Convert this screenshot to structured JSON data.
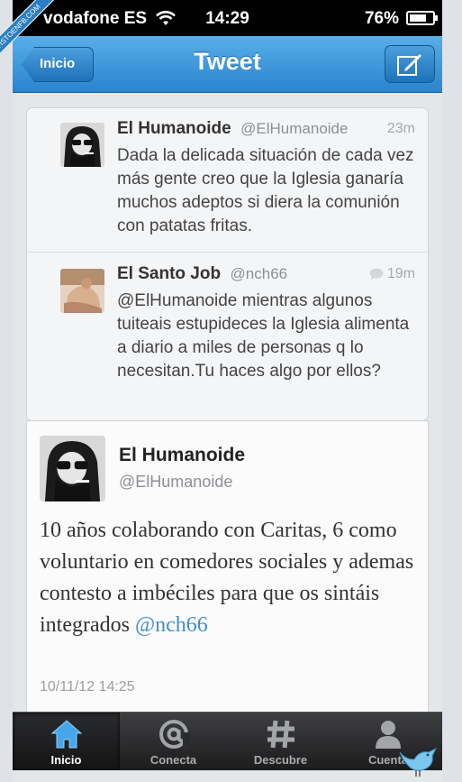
{
  "watermark": "VISTOENFB.COM",
  "status_bar": {
    "carrier": "vodafone ES",
    "time": "14:29",
    "battery_percent": "76%",
    "battery_level": 0.76
  },
  "nav": {
    "back_label": "Inicio",
    "title": "Tweet",
    "compose_icon": "compose-icon"
  },
  "context_tweets": [
    {
      "name": "El Humanoide",
      "handle": "@ElHumanoide",
      "time": "23m",
      "text": "Dada la delicada situación de cada vez más gente creo que la Iglesia ganaría muchos adeptos si diera la comunión con patatas fritas."
    },
    {
      "name": "El Santo Job",
      "handle": "@nch66",
      "time": "19m",
      "text": "@ElHumanoide mientras algunos tuiteais estupideces la Iglesia alimenta a diario a miles de personas q lo necesitan.Tu haces algo por ellos?"
    }
  ],
  "main_tweet": {
    "name": "El Humanoide",
    "handle": "@ElHumanoide",
    "text": "10 años colaborando con Caritas, 6 como voluntario en comedores sociales y ademas contesto a imbéciles para que os sintáis integrados",
    "mention": "@nch66",
    "date": "10/11/12 14:25"
  },
  "tabbar": {
    "tabs": [
      {
        "label": "Inicio",
        "icon": "home-icon",
        "active": true
      },
      {
        "label": "Conecta",
        "icon": "at-icon",
        "active": false
      },
      {
        "label": "Descubre",
        "icon": "hash-icon",
        "active": false
      },
      {
        "label": "Cuenta",
        "icon": "person-icon",
        "active": false
      }
    ]
  },
  "colors": {
    "nav_blue": "#2a85cf",
    "link_blue": "#3d8fcf",
    "tab_dark": "#1c1c1d"
  }
}
